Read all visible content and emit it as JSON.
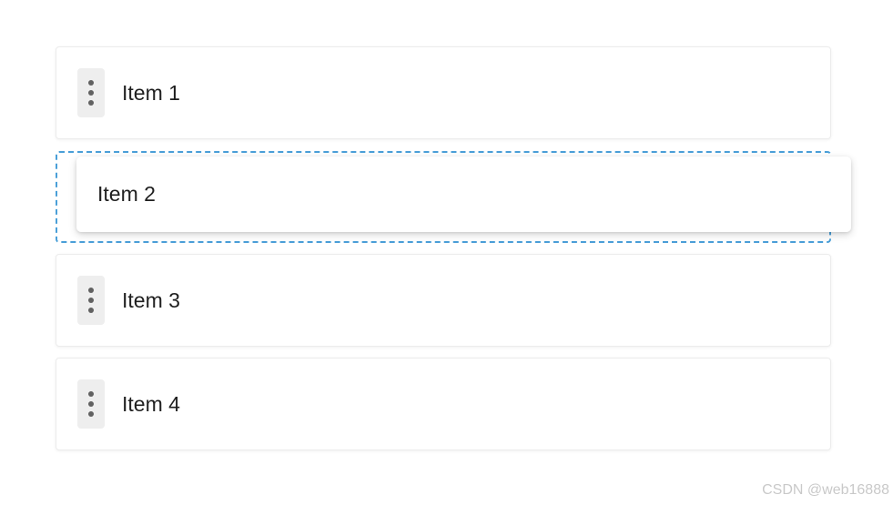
{
  "list": {
    "items": [
      {
        "label": "Item 1"
      },
      {
        "label": "Item 2"
      },
      {
        "label": "Item 3"
      },
      {
        "label": "Item 4"
      }
    ],
    "handle_icon": "drag-handle-vertical-dots-icon"
  },
  "drag": {
    "dragging_label": "Item 2",
    "drop_indicator_color": "#4a9fd8"
  },
  "watermark": {
    "text": "CSDN @web16888"
  }
}
